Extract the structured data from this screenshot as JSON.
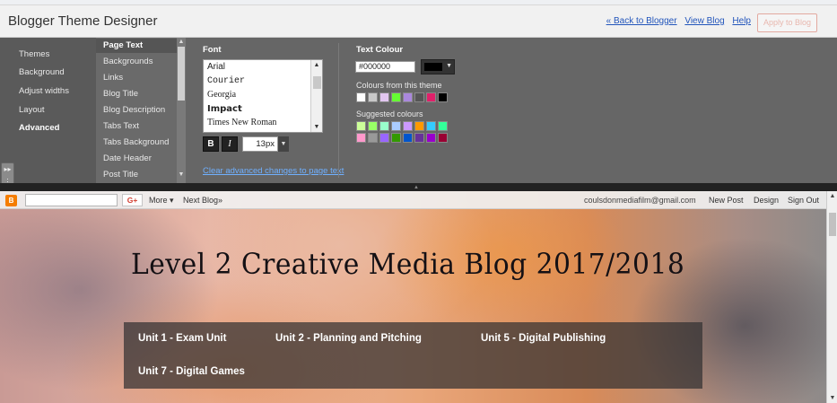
{
  "designer": {
    "title": "Blogger Theme Designer",
    "links": {
      "back": "« Back to Blogger",
      "view": "View Blog",
      "help": "Help"
    },
    "apply_label": "Apply to Blog"
  },
  "nav": [
    "Themes",
    "Background",
    "Adjust widths",
    "Layout",
    "Advanced"
  ],
  "nav_active": "Advanced",
  "subnav": [
    "Page Text",
    "Backgrounds",
    "Links",
    "Blog Title",
    "Blog Description",
    "Tabs Text",
    "Tabs Background",
    "Date Header",
    "Post Title"
  ],
  "subnav_active": "Page Text",
  "font_panel": {
    "label": "Font",
    "fonts": [
      "Arial",
      "Courier",
      "Georgia",
      "Impact",
      "Times New Roman"
    ],
    "bold_label": "B",
    "italic_label": "I",
    "size": "13px",
    "clear_link": "Clear advanced changes to page text"
  },
  "colour_panel": {
    "label": "Text Colour",
    "value": "#000000",
    "theme_label": "Colours from this theme",
    "suggested_label": "Suggested colours",
    "theme_colors": [
      "#ffffff",
      "#c8c8c8",
      "#e2c6f0",
      "#66ff33",
      "#aa88dd",
      "#555555",
      "#e0206a",
      "#000000"
    ],
    "suggested_row1": [
      "#ccff99",
      "#99ff66",
      "#99ffcc",
      "#aaccff",
      "#cc99ff",
      "#ff9900",
      "#33ccff",
      "#33ff99"
    ],
    "suggested_row2": [
      "#ff99cc",
      "#999999",
      "#9966ff",
      "#339900",
      "#0055cc",
      "#663399",
      "#9900cc",
      "#990033"
    ]
  },
  "blog_nav": {
    "more": "More ▾",
    "next_blog": "Next Blog»",
    "gplus": "G+",
    "email": "coulsdonmediafilm@gmail.com",
    "new_post": "New Post",
    "design": "Design",
    "sign_out": "Sign Out"
  },
  "blog": {
    "title": "Level 2 Creative Media Blog 2017/2018",
    "menu": [
      "Unit 1 - Exam Unit",
      "Unit 2 - Planning and Pitching",
      "Unit 5 - Digital Publishing",
      "Unit 7 - Digital Games"
    ]
  }
}
